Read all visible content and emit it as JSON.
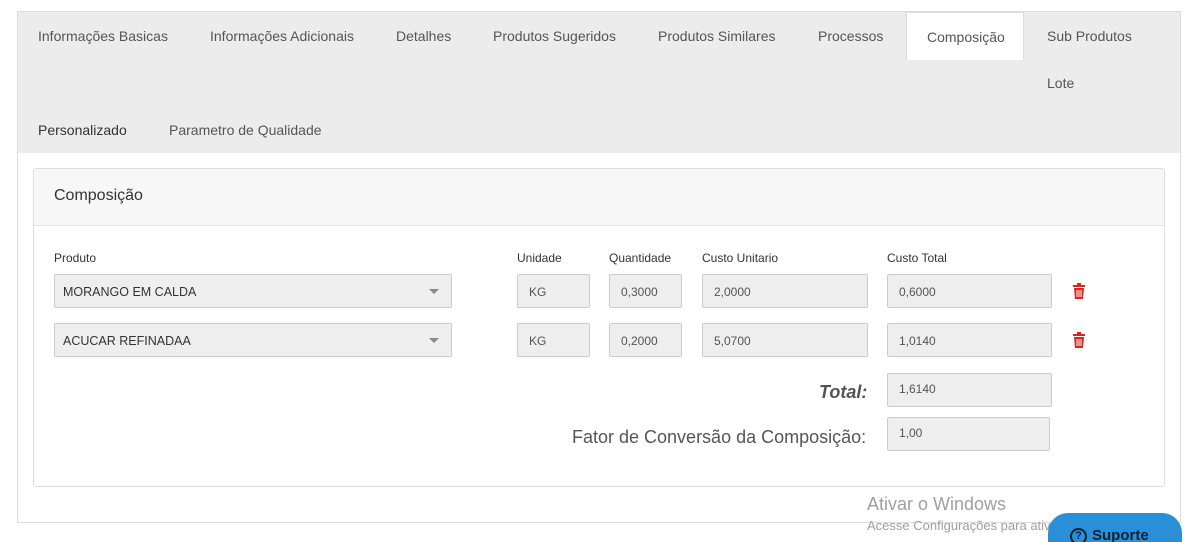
{
  "tabs": [
    {
      "label": "Informações Basicas"
    },
    {
      "label": "Informações Adicionais"
    },
    {
      "label": "Detalhes"
    },
    {
      "label": "Produtos Sugeridos"
    },
    {
      "label": "Produtos Similares"
    },
    {
      "label": "Processos"
    },
    {
      "label": "Composição",
      "active": true
    },
    {
      "label": "Sub Produtos"
    },
    {
      "label": "Lote"
    },
    {
      "label": "Personalizado"
    },
    {
      "label": "Parametro de Qualidade"
    }
  ],
  "panel": {
    "title": "Composição"
  },
  "columns": {
    "produto": "Produto",
    "unidade": "Unidade",
    "quantidade": "Quantidade",
    "custo_unitario": "Custo Unitario",
    "custo_total": "Custo Total"
  },
  "rows": [
    {
      "produto": "MORANGO EM CALDA",
      "unidade": "KG",
      "quantidade": "0,3000",
      "custo_unitario": "2,0000",
      "custo_total": "0,6000"
    },
    {
      "produto": "ACUCAR REFINADAA",
      "unidade": "KG",
      "quantidade": "0,2000",
      "custo_unitario": "5,0700",
      "custo_total": "1,0140"
    }
  ],
  "total": {
    "label": "Total:",
    "value": "1,6140"
  },
  "fator": {
    "label": "Fator de Conversão da Composição:",
    "value": "1,00"
  },
  "watermark": {
    "title": "Ativar o Windows",
    "subtitle": "Acesse Configurações para ativar o Windows."
  },
  "support": {
    "label": "Suporte",
    "icon": "question-circle-icon"
  },
  "colors": {
    "tabbar": "#ececec",
    "delete_icon": "#d9251c",
    "support_bg": "#2a8fd7"
  }
}
